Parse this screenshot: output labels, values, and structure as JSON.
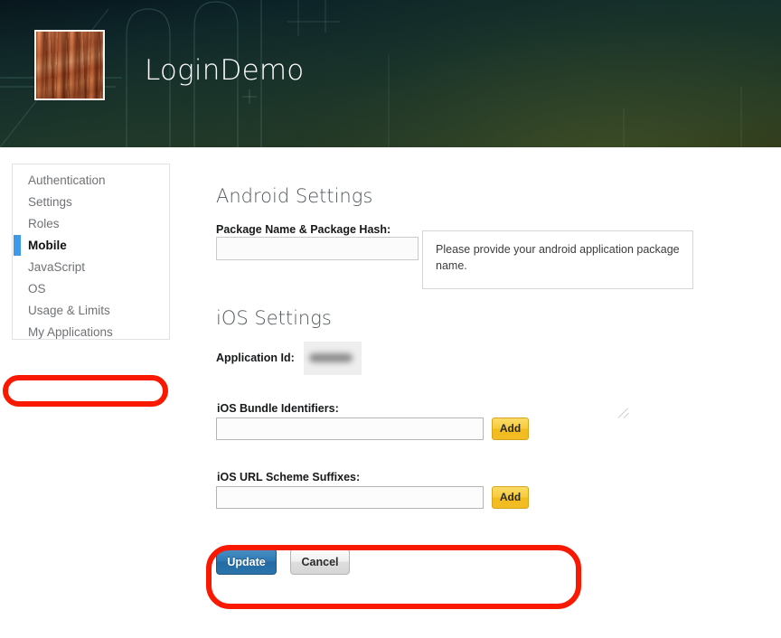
{
  "header": {
    "app_title": "LoginDemo",
    "logo_icon": "wood-texture-app-logo",
    "background_colors": {
      "top": "#03121c",
      "bottom": "#222d15"
    }
  },
  "sidebar": {
    "items": [
      {
        "label": "Authentication",
        "active": false
      },
      {
        "label": "Settings",
        "active": false
      },
      {
        "label": "Roles",
        "active": false
      },
      {
        "label": "Mobile",
        "active": true
      },
      {
        "label": "JavaScript",
        "active": false
      },
      {
        "label": "OS",
        "active": false
      },
      {
        "label": "Usage & Limits",
        "active": false
      },
      {
        "label": "My Applications",
        "active": false
      }
    ],
    "active_indicator_color": "#3d9ae8"
  },
  "annotations": {
    "color": "#f91800",
    "mobile_highlight": "red-oval-around-mobile-nav-item",
    "bundle_highlight": "red-oval-around-ios-bundle-identifiers"
  },
  "main": {
    "android": {
      "section_title": "Android Settings",
      "package_label": "Package Name & Package Hash:",
      "package_value": "",
      "package_placeholder": "",
      "tooltip_text": "Please provide your android application package name."
    },
    "ios": {
      "section_title": "iOS Settings",
      "application_id_label": "Application Id:",
      "application_id_value": "",
      "bundle_label": "iOS Bundle Identifiers:",
      "bundle_value": "",
      "bundle_add_label": "Add",
      "url_scheme_label": "iOS URL Scheme Suffixes:",
      "url_scheme_value": "",
      "url_scheme_add_label": "Add"
    },
    "actions": {
      "update_label": "Update",
      "cancel_label": "Cancel",
      "update_color": "#2a74ac",
      "add_color": "#f3bc1e"
    }
  }
}
